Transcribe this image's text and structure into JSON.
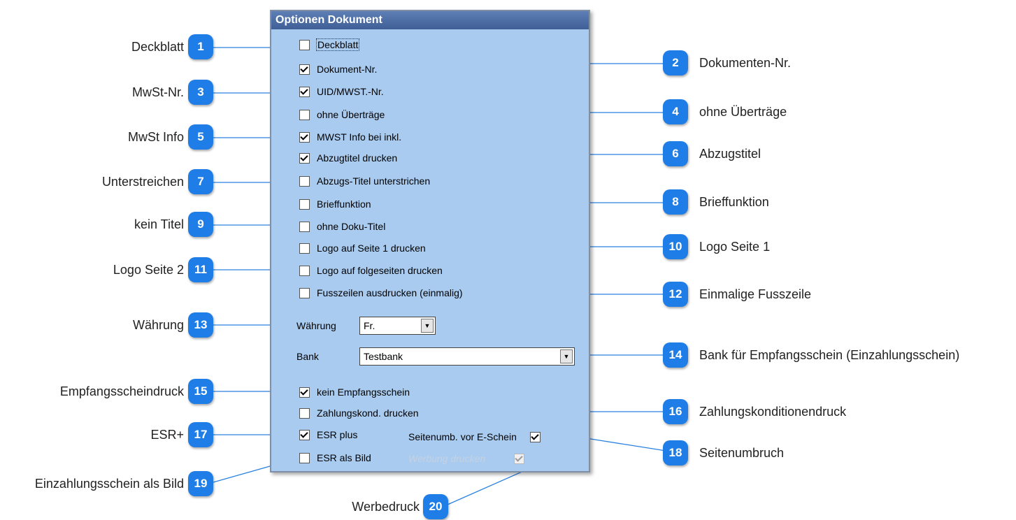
{
  "panel": {
    "title": "Optionen Dokument",
    "options": [
      {
        "label": "Deckblatt",
        "checked": false
      },
      {
        "label": "Dokument-Nr.",
        "checked": true
      },
      {
        "label": "UID/MWST.-Nr.",
        "checked": true
      },
      {
        "label": "ohne Überträge",
        "checked": false
      },
      {
        "label": "MWST Info bei inkl.",
        "checked": true
      },
      {
        "label": "Abzugtitel drucken",
        "checked": true
      },
      {
        "label": "Abzugs-Titel unterstrichen",
        "checked": false
      },
      {
        "label": "Brieffunktion",
        "checked": false
      },
      {
        "label": "ohne Doku-Titel",
        "checked": false
      },
      {
        "label": "Logo auf Seite 1 drucken",
        "checked": false
      },
      {
        "label": "Logo auf folgeseiten drucken",
        "checked": false
      },
      {
        "label": "Fusszeilen ausdrucken (einmalig)",
        "checked": false
      }
    ],
    "currency": {
      "label": "Währung",
      "value": "Fr."
    },
    "bank": {
      "label": "Bank",
      "value": "Testbank"
    },
    "kein_empfangsschein": {
      "label": "kein Empfangsschein",
      "checked": true
    },
    "zahlungskond": {
      "label": "Zahlungskond. drucken",
      "checked": false
    },
    "esr_plus": {
      "label": "ESR plus",
      "checked": true
    },
    "esr_bild": {
      "label": "ESR als Bild",
      "checked": false
    },
    "seitenumbruch": {
      "label": "Seitenumb. vor E-Schein",
      "checked": true
    },
    "werbung": {
      "label": "Werbung drucken",
      "checked": true,
      "disabled": true
    }
  },
  "callouts": {
    "c1": "Deckblatt",
    "c2": "Dokumenten-Nr.",
    "c3": "MwSt-Nr.",
    "c4": "ohne Überträge",
    "c5": "MwSt Info",
    "c6": "Abzugstitel",
    "c7": "Unterstreichen",
    "c8": "Brieffunktion",
    "c9": "kein Titel",
    "c10": "Logo Seite 1",
    "c11": "Logo Seite 2",
    "c12": "Einmalige Fusszeile",
    "c13": "Währung",
    "c14": "Bank für Empfangsschein (Einzahlungsschein)",
    "c15": "Empfangsscheindruck",
    "c16": "Zahlungskonditionendruck",
    "c17": "ESR+",
    "c18": "Seitenumbruch",
    "c19": "Einzahlungsschein als Bild",
    "c20": "Werbedruck"
  },
  "badges": {
    "b1": "1",
    "b2": "2",
    "b3": "3",
    "b4": "4",
    "b5": "5",
    "b6": "6",
    "b7": "7",
    "b8": "8",
    "b9": "9",
    "b10": "10",
    "b11": "11",
    "b12": "12",
    "b13": "13",
    "b14": "14",
    "b15": "15",
    "b16": "16",
    "b17": "17",
    "b18": "18",
    "b19": "19",
    "b20": "20"
  },
  "colors": {
    "badge": "#1e7de6",
    "panel": "#a9cbef",
    "title_bar": "#3f5f96",
    "leader": "#1e7de6"
  }
}
